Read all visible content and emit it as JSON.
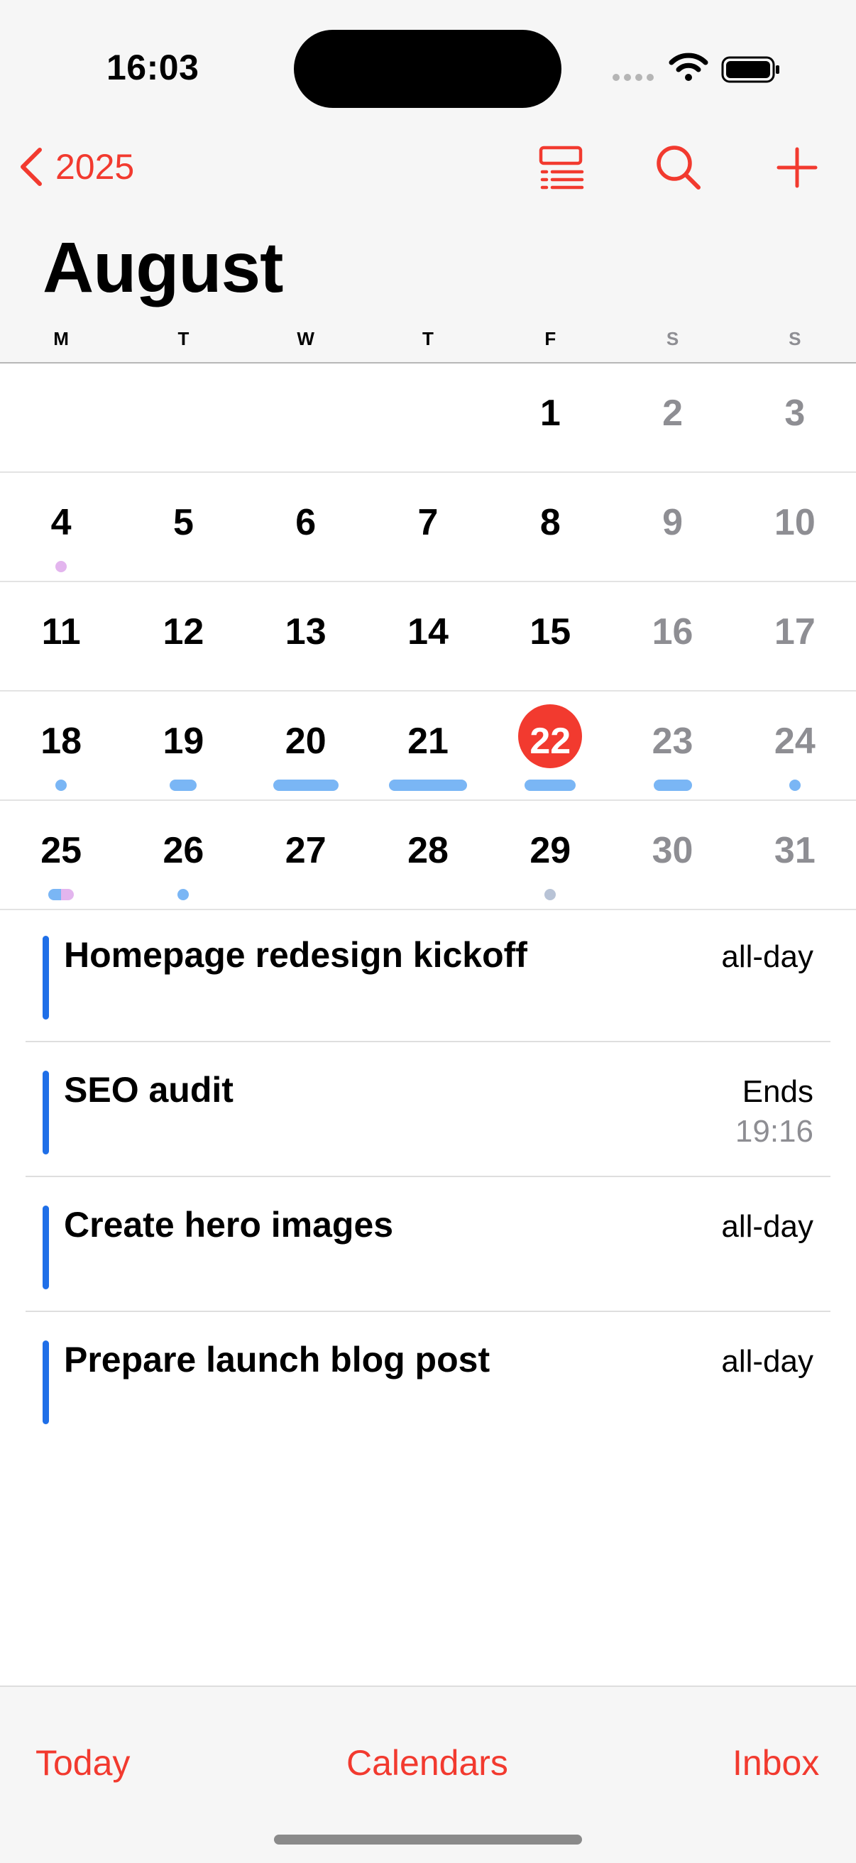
{
  "status_bar": {
    "time": "16:03"
  },
  "nav": {
    "back_label": "2025"
  },
  "month": "August",
  "weekdays": [
    "M",
    "T",
    "W",
    "T",
    "F",
    "S",
    "S"
  ],
  "weeks": [
    [
      "",
      "",
      "",
      "",
      "1",
      "2",
      "3"
    ],
    [
      "4",
      "5",
      "6",
      "7",
      "8",
      "9",
      "10"
    ],
    [
      "11",
      "12",
      "13",
      "14",
      "15",
      "16",
      "17"
    ],
    [
      "18",
      "19",
      "20",
      "21",
      "22",
      "23",
      "24"
    ],
    [
      "25",
      "26",
      "27",
      "28",
      "29",
      "30",
      "31"
    ]
  ],
  "today": "22",
  "events": [
    {
      "title": "Homepage redesign kickoff",
      "time": "all-day",
      "time_sub": ""
    },
    {
      "title": "SEO audit",
      "time": "Ends",
      "time_sub": "19:16"
    },
    {
      "title": "Create hero images",
      "time": "all-day",
      "time_sub": ""
    },
    {
      "title": "Prepare launch blog post",
      "time": "all-day",
      "time_sub": ""
    }
  ],
  "tab_bar": {
    "today": "Today",
    "calendars": "Calendars",
    "inbox": "Inbox"
  },
  "colors": {
    "accent": "#f23a2f",
    "event_blue": "#1f6fe8",
    "marker_blue": "#7ab6f5",
    "marker_purple": "#e3b5ee",
    "marker_gray": "#b8c3d6"
  }
}
